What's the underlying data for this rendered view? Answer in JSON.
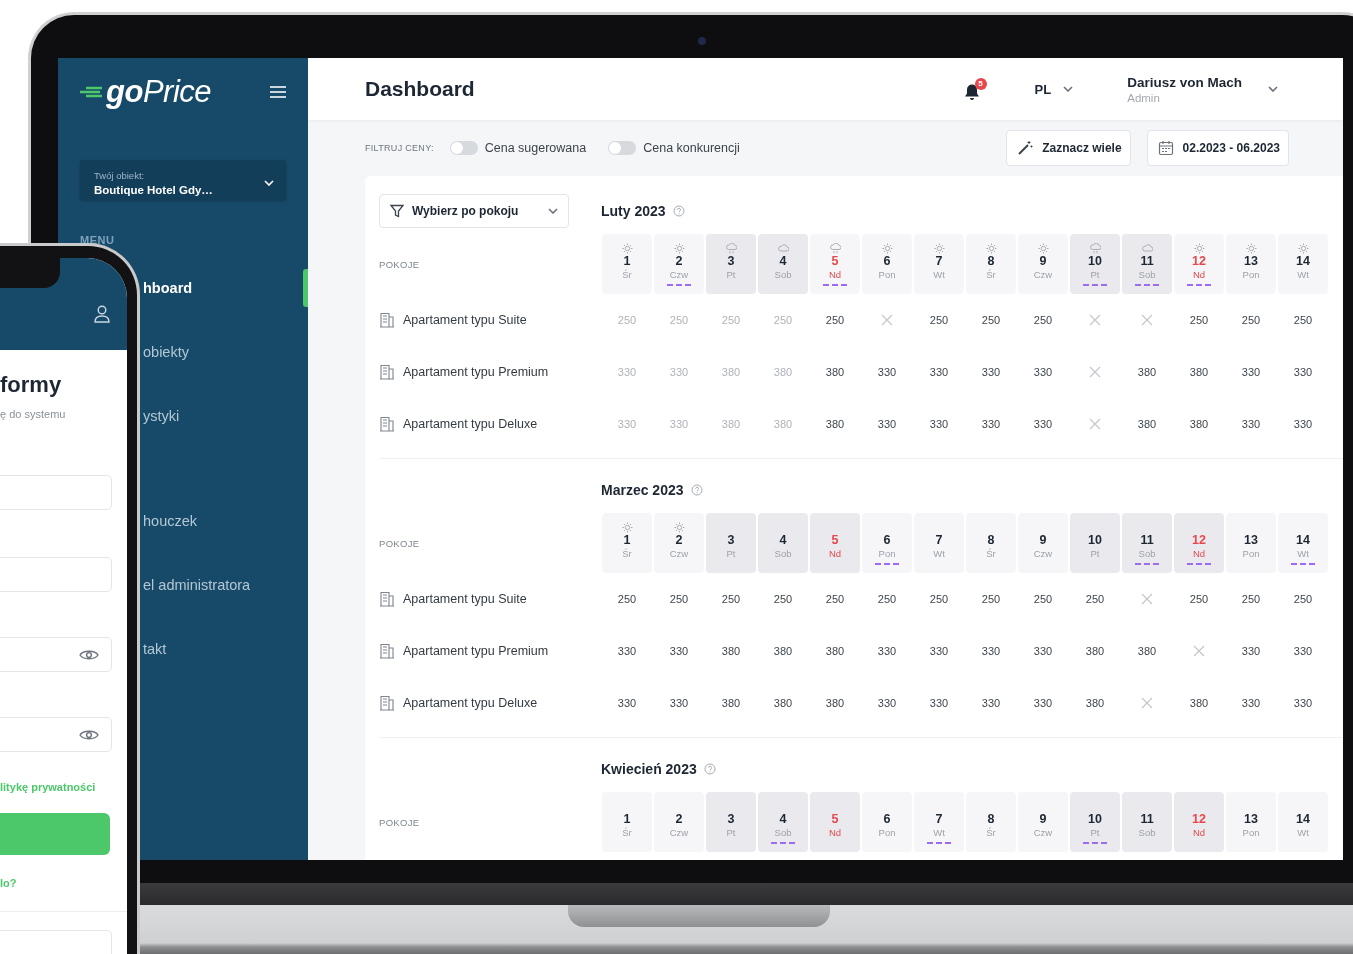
{
  "sidebar": {
    "logo": "**go**Price",
    "object_label": "Twój obiekt:",
    "object_value": "Boutique Hotel Gdy…",
    "menu_heading": "MENU",
    "items": [
      {
        "label": "hboard",
        "selected": true
      },
      {
        "label": "obiekty",
        "selected": false
      },
      {
        "label": "ystyki",
        "selected": false
      },
      {
        "label": "houczek",
        "selected": false
      },
      {
        "label": "el administratora",
        "selected": false
      },
      {
        "label": "takt",
        "selected": false
      }
    ]
  },
  "header": {
    "title": "Dashboard",
    "notifications": "5",
    "language": "PL",
    "user_name": "Dariusz von Mach",
    "user_role": "Admin"
  },
  "filters": {
    "label": "FILTRUJ CENY:",
    "toggles": [
      {
        "label": "Cena sugerowana",
        "on": false
      },
      {
        "label": "Cena konkurencji",
        "on": false
      }
    ],
    "select_many": "Zaznacz wiele",
    "date_range": "02.2023 - 06.2023"
  },
  "room_filter": "Wybierz po pokoju",
  "months": [
    {
      "title": "Luty 2023",
      "rooms_label": "POKOJE",
      "days": [
        {
          "day": "1",
          "weekday": "Śr",
          "kind": "sun",
          "shaded": false,
          "holiday": false,
          "marked": false
        },
        {
          "day": "2",
          "weekday": "Czw",
          "kind": "sun",
          "shaded": false,
          "holiday": false,
          "marked": true
        },
        {
          "day": "3",
          "weekday": "Pt",
          "kind": "rain",
          "shaded": true,
          "holiday": false,
          "marked": false
        },
        {
          "day": "4",
          "weekday": "Sob",
          "kind": "cloud",
          "shaded": true,
          "holiday": false,
          "marked": false
        },
        {
          "day": "5",
          "weekday": "Nd",
          "kind": "rain",
          "shaded": false,
          "holiday": true,
          "marked": true
        },
        {
          "day": "6",
          "weekday": "Pon",
          "kind": "sun",
          "shaded": false,
          "holiday": false,
          "marked": false
        },
        {
          "day": "7",
          "weekday": "Wt",
          "kind": "sun",
          "shaded": false,
          "holiday": false,
          "marked": false
        },
        {
          "day": "8",
          "weekday": "Śr",
          "kind": "sun",
          "shaded": false,
          "holiday": false,
          "marked": false
        },
        {
          "day": "9",
          "weekday": "Czw",
          "kind": "sun",
          "shaded": false,
          "holiday": false,
          "marked": false
        },
        {
          "day": "10",
          "weekday": "Pt",
          "kind": "rain",
          "shaded": true,
          "holiday": false,
          "marked": true
        },
        {
          "day": "11",
          "weekday": "Sob",
          "kind": "cloud",
          "shaded": true,
          "holiday": false,
          "marked": true
        },
        {
          "day": "12",
          "weekday": "Nd",
          "kind": "sun",
          "shaded": false,
          "holiday": true,
          "marked": true
        },
        {
          "day": "13",
          "weekday": "Pon",
          "kind": "sun",
          "shaded": false,
          "holiday": false,
          "marked": false
        },
        {
          "day": "14",
          "weekday": "Wt",
          "kind": "sun",
          "shaded": false,
          "holiday": false,
          "marked": false
        }
      ],
      "rows": [
        {
          "name": "Apartament typu Suite",
          "cells": [
            {
              "kind": "price",
              "price": "250",
              "faded": true
            },
            {
              "kind": "price",
              "price": "250",
              "faded": true
            },
            {
              "kind": "price",
              "price": "250",
              "faded": true
            },
            {
              "kind": "price",
              "price": "250",
              "faded": true
            },
            {
              "kind": "price",
              "price": "250",
              "faded": false
            },
            {
              "kind": "unavailable"
            },
            {
              "kind": "price",
              "price": "250",
              "faded": false
            },
            {
              "kind": "price",
              "price": "250",
              "faded": false
            },
            {
              "kind": "price",
              "price": "250",
              "faded": false
            },
            {
              "kind": "unavailable"
            },
            {
              "kind": "unavailable"
            },
            {
              "kind": "price",
              "price": "250",
              "faded": false
            },
            {
              "kind": "price",
              "price": "250",
              "faded": false
            },
            {
              "kind": "price",
              "price": "250",
              "faded": false
            }
          ]
        },
        {
          "name": "Apartament typu Premium",
          "cells": [
            {
              "kind": "price",
              "price": "330",
              "faded": true
            },
            {
              "kind": "price",
              "price": "330",
              "faded": true
            },
            {
              "kind": "price",
              "price": "380",
              "faded": true
            },
            {
              "kind": "price",
              "price": "380",
              "faded": true
            },
            {
              "kind": "price",
              "price": "380",
              "faded": false
            },
            {
              "kind": "price",
              "price": "330",
              "faded": false
            },
            {
              "kind": "price",
              "price": "330",
              "faded": false
            },
            {
              "kind": "price",
              "price": "330",
              "faded": false
            },
            {
              "kind": "price",
              "price": "330",
              "faded": false
            },
            {
              "kind": "unavailable"
            },
            {
              "kind": "price",
              "price": "380",
              "faded": false
            },
            {
              "kind": "price",
              "price": "380",
              "faded": false
            },
            {
              "kind": "price",
              "price": "330",
              "faded": false
            },
            {
              "kind": "price",
              "price": "330",
              "faded": false
            }
          ]
        },
        {
          "name": "Apartament typu Deluxe",
          "cells": [
            {
              "kind": "price",
              "price": "330",
              "faded": true
            },
            {
              "kind": "price",
              "price": "330",
              "faded": true
            },
            {
              "kind": "price",
              "price": "380",
              "faded": true
            },
            {
              "kind": "price",
              "price": "380",
              "faded": true
            },
            {
              "kind": "price",
              "price": "380",
              "faded": false
            },
            {
              "kind": "price",
              "price": "330",
              "faded": false
            },
            {
              "kind": "price",
              "price": "330",
              "faded": false
            },
            {
              "kind": "price",
              "price": "330",
              "faded": false
            },
            {
              "kind": "price",
              "price": "330",
              "faded": false
            },
            {
              "kind": "unavailable"
            },
            {
              "kind": "price",
              "price": "380",
              "faded": false
            },
            {
              "kind": "price",
              "price": "380",
              "faded": false
            },
            {
              "kind": "price",
              "price": "330",
              "faded": false
            },
            {
              "kind": "price",
              "price": "330",
              "faded": false
            }
          ]
        }
      ]
    },
    {
      "title": "Marzec 2023",
      "rooms_label": "POKOJE",
      "days": [
        {
          "day": "1",
          "weekday": "Śr",
          "kind": "sun",
          "shaded": false,
          "holiday": false,
          "marked": false
        },
        {
          "day": "2",
          "weekday": "Czw",
          "kind": "sun",
          "shaded": false,
          "holiday": false,
          "marked": false
        },
        {
          "day": "3",
          "weekday": "Pt",
          "kind": "plain",
          "shaded": true,
          "holiday": false,
          "marked": false
        },
        {
          "day": "4",
          "weekday": "Sob",
          "kind": "plain",
          "shaded": true,
          "holiday": false,
          "marked": false
        },
        {
          "day": "5",
          "weekday": "Nd",
          "kind": "plain",
          "shaded": true,
          "holiday": true,
          "marked": false
        },
        {
          "day": "6",
          "weekday": "Pon",
          "kind": "plain",
          "shaded": false,
          "holiday": false,
          "marked": true
        },
        {
          "day": "7",
          "weekday": "Wt",
          "kind": "plain",
          "shaded": false,
          "holiday": false,
          "marked": false
        },
        {
          "day": "8",
          "weekday": "Śr",
          "kind": "plain",
          "shaded": false,
          "holiday": false,
          "marked": false
        },
        {
          "day": "9",
          "weekday": "Czw",
          "kind": "plain",
          "shaded": false,
          "holiday": false,
          "marked": false
        },
        {
          "day": "10",
          "weekday": "Pt",
          "kind": "plain",
          "shaded": true,
          "holiday": false,
          "marked": false
        },
        {
          "day": "11",
          "weekday": "Sob",
          "kind": "plain",
          "shaded": true,
          "holiday": false,
          "marked": true
        },
        {
          "day": "12",
          "weekday": "Nd",
          "kind": "plain",
          "shaded": true,
          "holiday": true,
          "marked": true
        },
        {
          "day": "13",
          "weekday": "Pon",
          "kind": "plain",
          "shaded": false,
          "holiday": false,
          "marked": false
        },
        {
          "day": "14",
          "weekday": "Wt",
          "kind": "plain",
          "shaded": false,
          "holiday": false,
          "marked": true
        }
      ],
      "rows": [
        {
          "name": "Apartament typu Suite",
          "cells": [
            {
              "kind": "price",
              "price": "250"
            },
            {
              "kind": "price",
              "price": "250"
            },
            {
              "kind": "price",
              "price": "250"
            },
            {
              "kind": "price",
              "price": "250"
            },
            {
              "kind": "price",
              "price": "250"
            },
            {
              "kind": "price",
              "price": "250"
            },
            {
              "kind": "price",
              "price": "250"
            },
            {
              "kind": "price",
              "price": "250"
            },
            {
              "kind": "price",
              "price": "250"
            },
            {
              "kind": "price",
              "price": "250"
            },
            {
              "kind": "unavailable"
            },
            {
              "kind": "price",
              "price": "250"
            },
            {
              "kind": "price",
              "price": "250"
            },
            {
              "kind": "price",
              "price": "250"
            }
          ]
        },
        {
          "name": "Apartament typu Premium",
          "cells": [
            {
              "kind": "price",
              "price": "330"
            },
            {
              "kind": "price",
              "price": "330"
            },
            {
              "kind": "price",
              "price": "380"
            },
            {
              "kind": "price",
              "price": "380"
            },
            {
              "kind": "price",
              "price": "380"
            },
            {
              "kind": "price",
              "price": "330"
            },
            {
              "kind": "price",
              "price": "330"
            },
            {
              "kind": "price",
              "price": "330"
            },
            {
              "kind": "price",
              "price": "330"
            },
            {
              "kind": "price",
              "price": "380"
            },
            {
              "kind": "price",
              "price": "380"
            },
            {
              "kind": "unavailable"
            },
            {
              "kind": "price",
              "price": "330"
            },
            {
              "kind": "price",
              "price": "330"
            }
          ]
        },
        {
          "name": "Apartament typu Deluxe",
          "cells": [
            {
              "kind": "price",
              "price": "330"
            },
            {
              "kind": "price",
              "price": "330"
            },
            {
              "kind": "price",
              "price": "380"
            },
            {
              "kind": "price",
              "price": "380"
            },
            {
              "kind": "price",
              "price": "380"
            },
            {
              "kind": "price",
              "price": "330"
            },
            {
              "kind": "price",
              "price": "330"
            },
            {
              "kind": "price",
              "price": "330"
            },
            {
              "kind": "price",
              "price": "330"
            },
            {
              "kind": "price",
              "price": "380"
            },
            {
              "kind": "unavailable"
            },
            {
              "kind": "price",
              "price": "380"
            },
            {
              "kind": "price",
              "price": "330"
            },
            {
              "kind": "price",
              "price": "330"
            }
          ]
        }
      ]
    },
    {
      "title": "Kwiecień 2023",
      "rooms_label": "POKOJE",
      "days": [
        {
          "day": "1",
          "weekday": "Śr",
          "kind": "plain",
          "shaded": false,
          "holiday": false,
          "marked": false
        },
        {
          "day": "2",
          "weekday": "Czw",
          "kind": "plain",
          "shaded": false,
          "holiday": false,
          "marked": false
        },
        {
          "day": "3",
          "weekday": "Pt",
          "kind": "plain",
          "shaded": true,
          "holiday": false,
          "marked": false
        },
        {
          "day": "4",
          "weekday": "Sob",
          "kind": "plain",
          "shaded": true,
          "holiday": false,
          "marked": true
        },
        {
          "day": "5",
          "weekday": "Nd",
          "kind": "plain",
          "shaded": true,
          "holiday": true,
          "marked": false
        },
        {
          "day": "6",
          "weekday": "Pon",
          "kind": "plain",
          "shaded": false,
          "holiday": false,
          "marked": false
        },
        {
          "day": "7",
          "weekday": "Wt",
          "kind": "plain",
          "shaded": false,
          "holiday": false,
          "marked": true
        },
        {
          "day": "8",
          "weekday": "Śr",
          "kind": "plain",
          "shaded": false,
          "holiday": false,
          "marked": false
        },
        {
          "day": "9",
          "weekday": "Czw",
          "kind": "plain",
          "shaded": false,
          "holiday": false,
          "marked": false
        },
        {
          "day": "10",
          "weekday": "Pt",
          "kind": "plain",
          "shaded": true,
          "holiday": false,
          "marked": true
        },
        {
          "day": "11",
          "weekday": "Sob",
          "kind": "plain",
          "shaded": true,
          "holiday": false,
          "marked": false
        },
        {
          "day": "12",
          "weekday": "Nd",
          "kind": "plain",
          "shaded": true,
          "holiday": true,
          "marked": false
        },
        {
          "day": "13",
          "weekday": "Pon",
          "kind": "plain",
          "shaded": false,
          "holiday": false,
          "marked": false
        },
        {
          "day": "14",
          "weekday": "Wt",
          "kind": "plain",
          "shaded": false,
          "holiday": false,
          "marked": false
        }
      ]
    }
  ],
  "phone": {
    "heading": "formy",
    "subtitle": "ę do systemu",
    "fields": [
      {
        "kind": "text"
      },
      {
        "kind": "text"
      },
      {
        "kind": "password"
      },
      {
        "kind": "password"
      }
    ],
    "policy_link": "litykę prywatności",
    "forgot_link": "lo?"
  }
}
